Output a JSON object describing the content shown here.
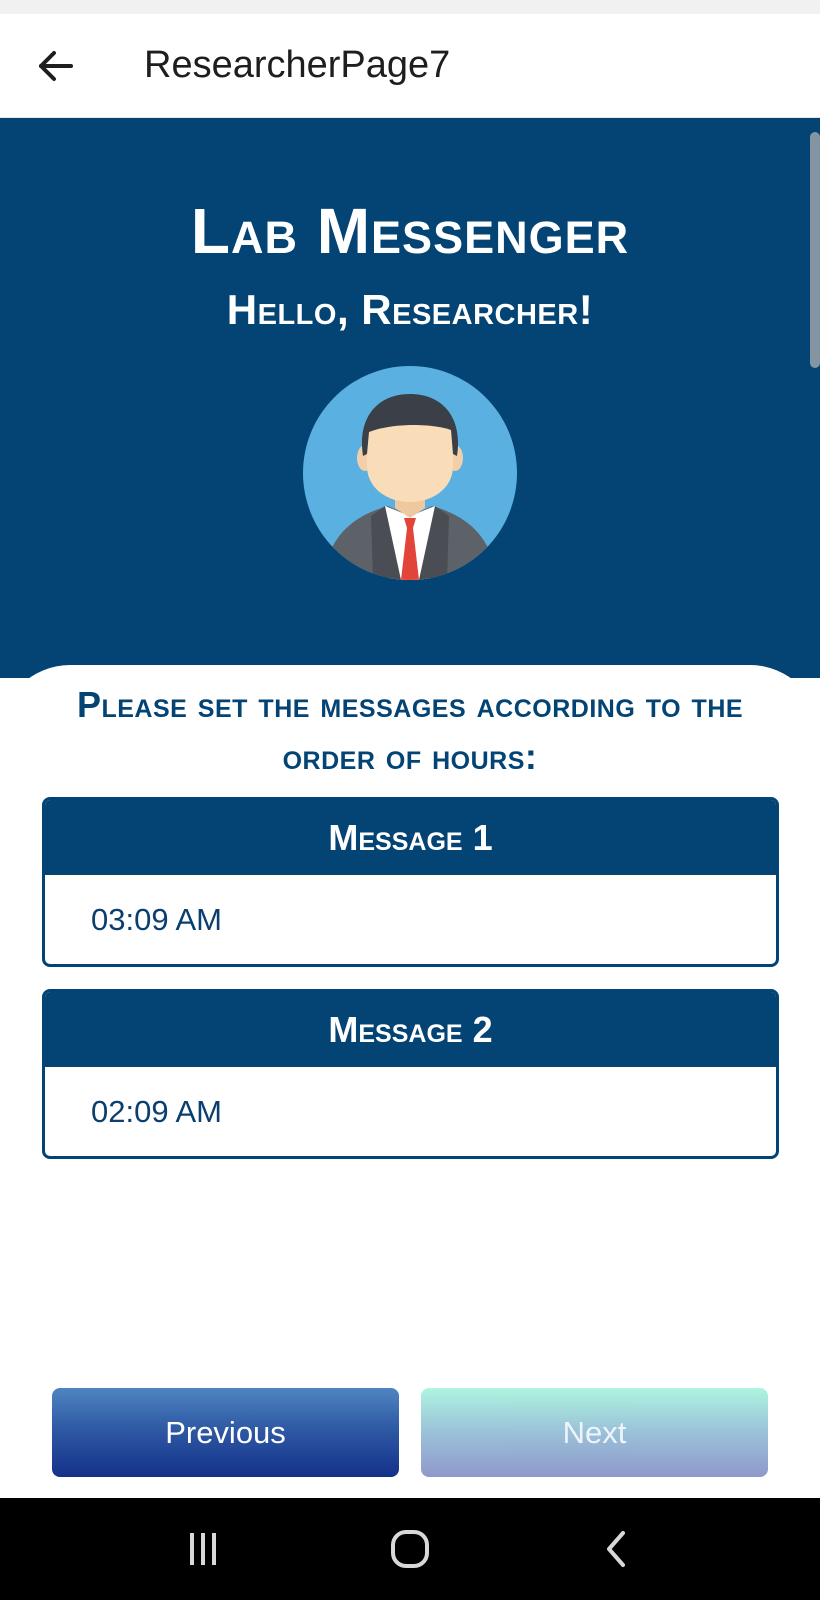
{
  "app_bar": {
    "title": "ResearcherPage7",
    "back_icon": "arrow-back-icon"
  },
  "hero": {
    "title": "Lab Messenger",
    "greeting": "Hello, Researcher!",
    "avatar_icon": "businessman-avatar-icon"
  },
  "card": {
    "instruction": "Please set the messages according to the order of hours:",
    "messages": [
      {
        "label": "Message 1",
        "time": "03:09 AM"
      },
      {
        "label": "Message 2",
        "time": "02:09 AM"
      }
    ]
  },
  "buttons": {
    "previous_label": "Previous",
    "next_label": "Next"
  },
  "nav": {
    "icons": [
      "recent-apps-icon",
      "home-icon",
      "back-icon"
    ]
  },
  "colors": {
    "primary": "#044475",
    "avatar_bg": "#5ab0e0"
  }
}
